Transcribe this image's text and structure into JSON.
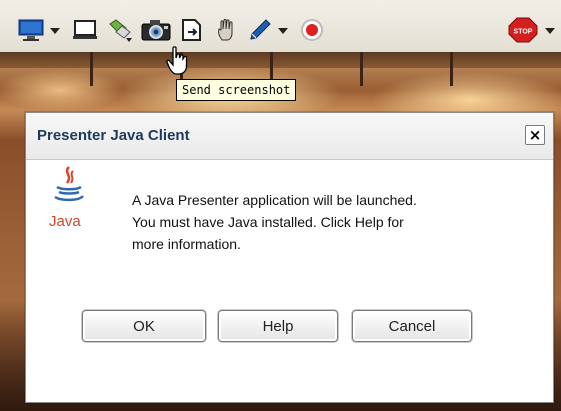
{
  "toolbar": {
    "icons": [
      "desktop-share-icon",
      "chevron-down-icon",
      "whiteboard-icon",
      "annotate-icon",
      "camera-icon",
      "file-share-icon",
      "hand-icon",
      "pen-icon",
      "chevron-down-icon",
      "record-icon",
      "stop-icon",
      "chevron-down-icon"
    ],
    "stop_label": "STOP"
  },
  "tooltip": {
    "text": "Send screenshot"
  },
  "dialog": {
    "title": "Presenter Java Client",
    "close_symbol": "×",
    "logo_text": "Java",
    "message_lines": [
      "A Java Presenter application will be launched.",
      "You must have Java installed. Click Help for",
      "more information."
    ],
    "buttons": {
      "ok": "OK",
      "help": "Help",
      "cancel": "Cancel"
    }
  },
  "colors": {
    "dialog_title": "#1d3a5c",
    "java_red": "#d8452b",
    "tooltip_bg": "#ffffe1"
  }
}
